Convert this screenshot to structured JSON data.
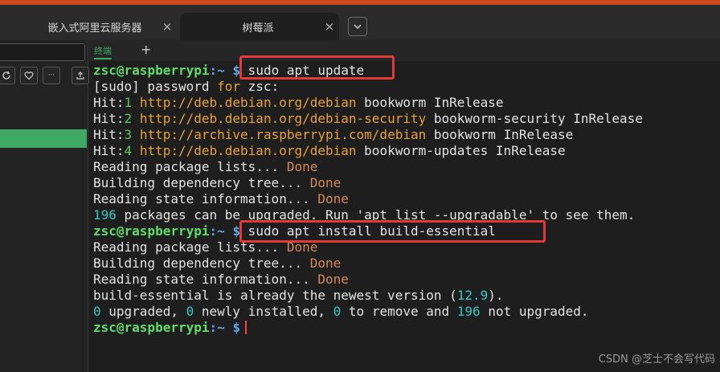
{
  "tabs": [
    {
      "label": "嵌入式阿里云服务器",
      "close": "×"
    },
    {
      "label": "树莓派",
      "close": "×"
    }
  ],
  "tab_dropdown_icon": "chevron-down-icon",
  "terminal_tab": {
    "label": "终端",
    "add": "+"
  },
  "sidebar": {
    "tools": [
      "refresh-icon",
      "heart-icon",
      "more-icon",
      "upload-icon"
    ],
    "more_glyph": "···"
  },
  "prompt": {
    "user": "zsc@raspberrypi",
    "path": ":~",
    "symbol": "$"
  },
  "commands": {
    "cmd1": " sudo apt update",
    "cmd2": " sudo apt install build-essential"
  },
  "output": {
    "sudo_prefix": "[sudo] password ",
    "sudo_for": "for",
    "sudo_suffix": " zsc:",
    "hits": [
      {
        "label": "Hit:",
        "num": "1",
        "url": "http://deb.debian.org/debian",
        "rest": " bookworm InRelease"
      },
      {
        "label": "Hit:",
        "num": "2",
        "url": "http://deb.debian.org/debian-security",
        "rest": " bookworm-security InRelease"
      },
      {
        "label": "Hit:",
        "num": "3",
        "url": "http://archive.raspberrypi.com/debian",
        "rest": " bookworm InRelease"
      },
      {
        "label": "Hit:",
        "num": "4",
        "url": "http://deb.debian.org/debian",
        "rest": " bookworm-updates InRelease"
      }
    ],
    "reading_lists": "Reading package lists... ",
    "building_tree": "Building dependency tree... ",
    "reading_state": "Reading state information... ",
    "done": "Done",
    "upgradable_num": "196",
    "upgradable_text": " packages can be upgraded. Run 'apt list --upgradable' to see them.",
    "newest_prefix": "build-essential is already the newest version (",
    "newest_version": "12.9",
    "newest_suffix": ").",
    "summary": {
      "n1": "0",
      "t1": " upgraded, ",
      "n2": "0",
      "t2": " newly installed, ",
      "n3": "0",
      "t3": " to remove and ",
      "n4": "196",
      "t4": " not upgraded."
    }
  },
  "watermark": "CSDN @芝士不会写代码",
  "colors": {
    "accent_green": "#3ea965",
    "highlight_red": "#e03a3a",
    "top_strip": "#c94a1c"
  }
}
